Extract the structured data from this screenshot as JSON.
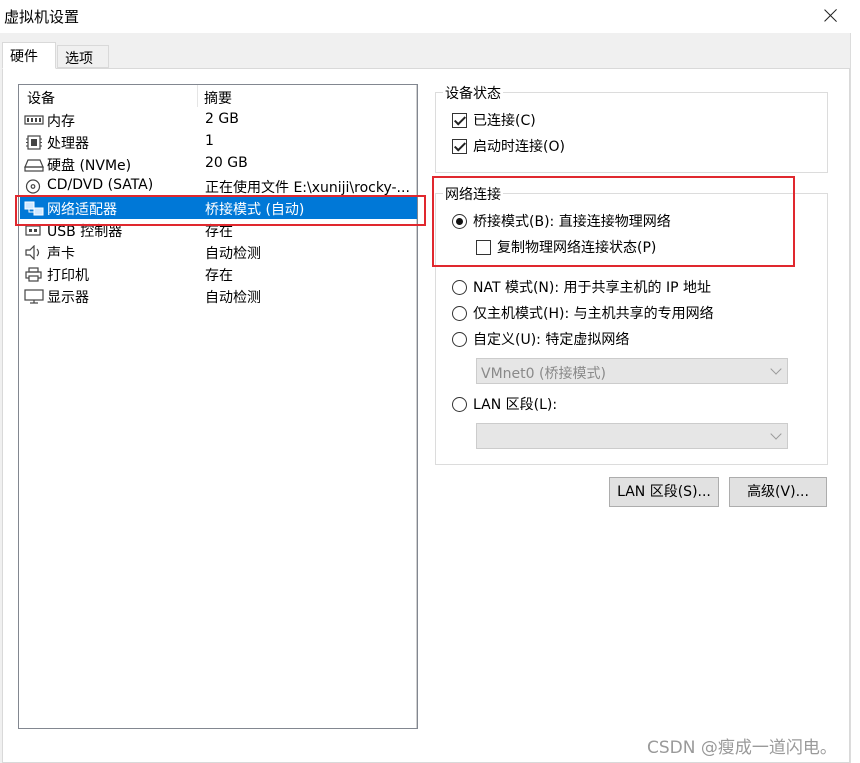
{
  "window": {
    "title": "虚拟机设置"
  },
  "tabs": [
    {
      "label": "硬件"
    },
    {
      "label": "选项"
    }
  ],
  "device_list": {
    "headers": {
      "device": "设备",
      "summary": "摘要"
    },
    "rows": [
      {
        "icon": "memory-icon",
        "name": "内存",
        "summary": "2 GB"
      },
      {
        "icon": "processor-icon",
        "name": "处理器",
        "summary": "1"
      },
      {
        "icon": "hard-disk-icon",
        "name": "硬盘 (NVMe)",
        "summary": "20 GB"
      },
      {
        "icon": "cd-dvd-icon",
        "name": "CD/DVD (SATA)",
        "summary": "正在使用文件 E:\\xuniji\\rocky-..."
      },
      {
        "icon": "network-adapter-icon",
        "name": "网络适配器",
        "summary": "桥接模式 (自动)",
        "selected": true
      },
      {
        "icon": "usb-icon",
        "name": "USB 控制器",
        "summary": "存在"
      },
      {
        "icon": "sound-card-icon",
        "name": "声卡",
        "summary": "自动检测"
      },
      {
        "icon": "printer-icon",
        "name": "打印机",
        "summary": "存在"
      },
      {
        "icon": "display-icon",
        "name": "显示器",
        "summary": "自动检测"
      }
    ]
  },
  "device_status": {
    "title": "设备状态",
    "connected": {
      "label": "已连接(C)",
      "checked": true
    },
    "connect_at_power_on": {
      "label": "启动时连接(O)",
      "checked": true
    }
  },
  "network_connection": {
    "title": "网络连接",
    "bridged": {
      "label": "桥接模式(B): 直接连接物理网络",
      "selected": true
    },
    "replicate_state": {
      "label": "复制物理网络连接状态(P)",
      "checked": false
    },
    "nat": {
      "label": "NAT 模式(N): 用于共享主机的 IP 地址",
      "selected": false
    },
    "host_only": {
      "label": "仅主机模式(H): 与主机共享的专用网络",
      "selected": false
    },
    "custom": {
      "label": "自定义(U): 特定虚拟网络",
      "selected": false
    },
    "custom_select_value": "VMnet0 (桥接模式)",
    "lan_segment": {
      "label": "LAN 区段(L):",
      "selected": false
    },
    "lan_select_value": ""
  },
  "buttons": {
    "lan_segments": "LAN 区段(S)...",
    "advanced": "高级(V)..."
  },
  "watermark": "CSDN @瘦成一道闪电。",
  "colors": {
    "selection": "#0078d7",
    "highlight_box": "#e0282e"
  }
}
